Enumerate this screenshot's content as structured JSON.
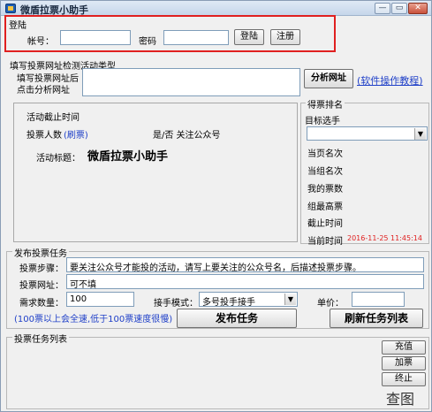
{
  "window": {
    "title": "微盾拉票小助手",
    "min_glyph": "—",
    "max_glyph": "▭",
    "close_glyph": "✕"
  },
  "login": {
    "group_label": "登陆",
    "account_label": "帐号：",
    "account_value": "",
    "password_label": "密码",
    "password_value": "",
    "login_button": "登陆",
    "register_button": "注册"
  },
  "vote_url": {
    "group_label": "填写投票网址检测活动类型",
    "hint_line1": "填写投票网址后",
    "hint_line2": "点击分析网址",
    "url_value": "",
    "analyze_button": "分析网址",
    "tutorial_link": "(软件操作教程)"
  },
  "activity": {
    "deadline_label": "活动截止时间",
    "voters_label": "投票人数",
    "voters_link": "(刷票)",
    "follow_label": "是/否 关注公众号",
    "title_label": "活动标题：",
    "title_value": "微盾拉票小助手"
  },
  "ranking": {
    "group_label": "得票排名",
    "target_label": "目标选手",
    "target_value": "",
    "current_page_rank": "当页名次",
    "current_group_rank": "当组名次",
    "my_votes": "我的票数",
    "group_max_votes": "组最高票",
    "deadline": "截止时间",
    "current_time_label": "当前时间",
    "current_time_value": "2016-11-25 11:45:14"
  },
  "task": {
    "group_label": "发布投票任务",
    "steps_label": "投票步骤：",
    "steps_value": "要关注公众号才能投的活动，请写上要关注的公众号名，后描述投票步骤。",
    "url_label": "投票网址：",
    "url_value": "可不填",
    "quantity_label": "需求数量：",
    "quantity_value": "100",
    "mode_label": "接手模式：",
    "mode_value": "多号投手接手",
    "price_label": "单价：",
    "price_value": "",
    "speed_note": "(100票以上会全速,低于100票速度很慢)",
    "publish_button": "发布任务",
    "refresh_button": "刷新任务列表"
  },
  "task_list": {
    "group_label": "投票任务列表",
    "recharge_button": "充值",
    "add_votes_button": "加票",
    "stop_button": "终止"
  },
  "watermark": "查图",
  "colors": {
    "highlight_border": "#e02020",
    "link": "#2040c8",
    "time_value": "#e02020"
  }
}
